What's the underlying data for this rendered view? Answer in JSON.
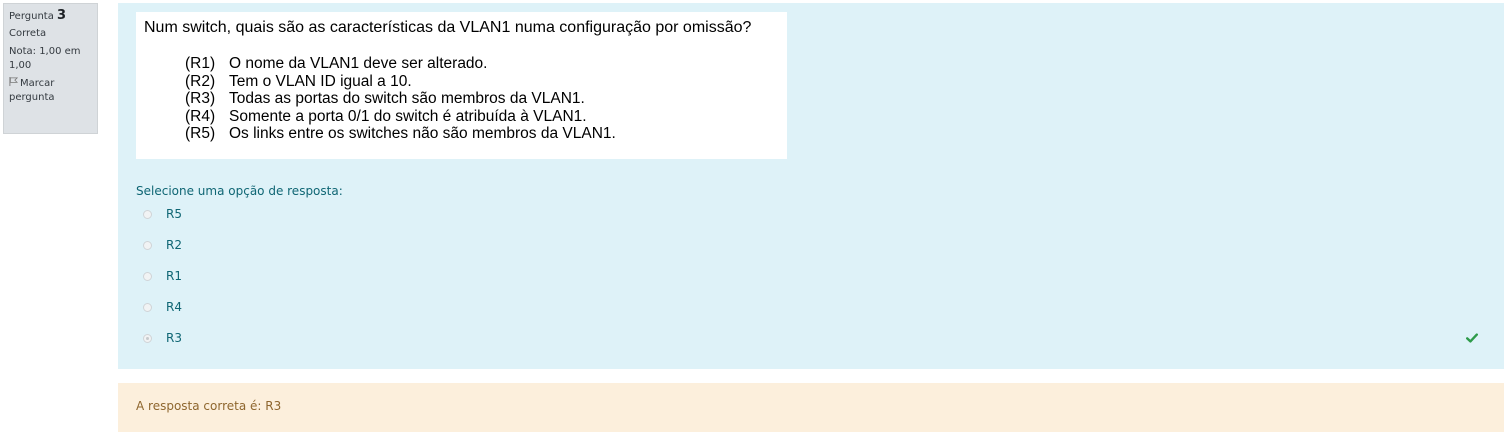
{
  "info": {
    "question_prefix": "Pergunta",
    "question_number": "3",
    "state": "Correta",
    "grade": "Nota: 1,00 em 1,00",
    "flag_label": "Marcar pergunta"
  },
  "question": {
    "title": "Num switch, quais são as características da VLAN1 numa configuração por omissão?",
    "items": [
      {
        "label": "(R1)",
        "text": "O nome da VLAN1 deve ser alterado."
      },
      {
        "label": "(R2)",
        "text": "Tem o VLAN ID igual a 10."
      },
      {
        "label": "(R3)",
        "text": "Todas as portas do switch são membros da VLAN1."
      },
      {
        "label": "(R4)",
        "text": "Somente a porta 0/1 do switch é atribuída à VLAN1."
      },
      {
        "label": "(R5)",
        "text": "Os links entre os switches não são membros da VLAN1."
      }
    ]
  },
  "answer_prompt": "Selecione uma opção de resposta:",
  "options": [
    {
      "label": "R5",
      "selected": false
    },
    {
      "label": "R2",
      "selected": false
    },
    {
      "label": "R1",
      "selected": false
    },
    {
      "label": "R4",
      "selected": false
    },
    {
      "label": "R3",
      "selected": true
    }
  ],
  "feedback": "A resposta correta é: R3",
  "colors": {
    "content_bg": "#def2f8",
    "feedback_bg": "#fcefdc",
    "correct_check": "#2e9b4a",
    "link_text": "#0f6674"
  },
  "icons": {
    "flag": "flag-icon",
    "correct": "check-icon"
  }
}
